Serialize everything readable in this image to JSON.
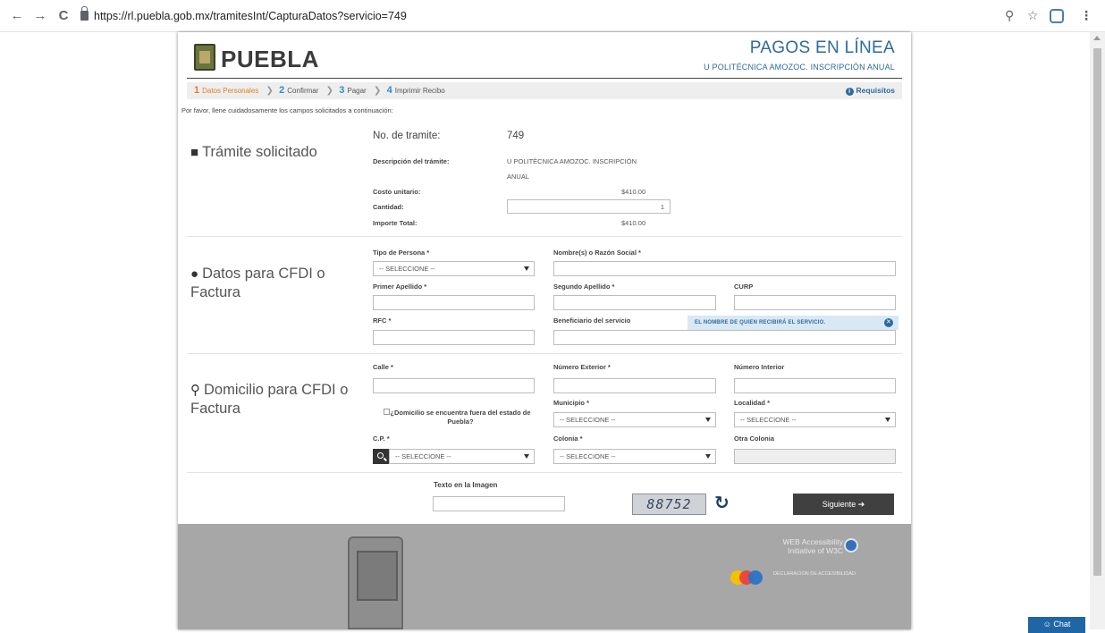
{
  "browser": {
    "url": "https://rl.puebla.gob.mx/tramitesInt/CapturaDatos?servicio=749",
    "back_icon": "←",
    "forward_icon": "→",
    "reload_icon": "C",
    "zoom_icon": "⚲",
    "star_icon": "☆",
    "menu_icon": "⋮"
  },
  "header": {
    "brand": "PUEBLA",
    "title": "PAGOS EN LÍNEA",
    "subtitle": "U POLITÉCNICA AMOZOC. INSCRIPCIÓN ANUAL"
  },
  "steps": [
    {
      "num": "1",
      "label": "Datos Personales"
    },
    {
      "num": "2",
      "label": "Confirmar"
    },
    {
      "num": "3",
      "label": "Pagar"
    },
    {
      "num": "4",
      "label": "Imprimir Recibo"
    }
  ],
  "requisitos": "Requisitos",
  "intro": "Por favor, llene cuidadosamente los campos solicitados a continuación:",
  "tramite": {
    "section_title": "Trámite solicitado",
    "no_label": "No. de tramite:",
    "no_value": "749",
    "desc_label": "Descripción del trámite:",
    "desc_value_line1": "U POLITÉCNICA AMOZOC. INSCRIPCIÓN",
    "desc_value_line2": "ANUAL",
    "costo_label": "Costo unitario:",
    "costo_value": "$410.00",
    "cantidad_label": "Cantidad:",
    "cantidad_value": "1",
    "importe_label": "Importe Total:",
    "importe_value": "$410.00"
  },
  "cfdi": {
    "section_title": "Datos para CFDI o Factura",
    "tipo_persona_label": "Tipo de Persona *",
    "tipo_persona_value": "-- SELECCIONE --",
    "nombre_label": "Nombre(s) o Razón Social *",
    "primer_apellido_label": "Primer Apellido *",
    "segundo_apellido_label": "Segundo Apellido *",
    "curp_label": "CURP",
    "rfc_label": "RFC *",
    "beneficiario_label": "Beneficiario del servicio",
    "tooltip": "EL NOMBRE DE QUIEN RECIBIRÁ EL SERVICIO."
  },
  "domicilio": {
    "section_title": "Domicilio para CFDI o Factura",
    "calle_label": "Calle *",
    "num_ext_label": "Número Exterior *",
    "num_int_label": "Número Interior",
    "municipio_label": "Municipio *",
    "localidad_label": "Localidad *",
    "fuera_label": "¿Domicilio se encuentra fuera del estado de Puebla?",
    "cp_label": "C.P. *",
    "colonia_label": "Colonia *",
    "otra_colonia_label": "Otra Colonia",
    "select_placeholder": "-- SELECCIONE --"
  },
  "captcha": {
    "label": "Texto en la Imagen",
    "image_text": "88752",
    "refresh_icon": "↻",
    "next_button": "Siguiente ➔"
  },
  "footer": {
    "w3c_text": "WEB Accessibility Initiative of W3C",
    "declaracion": "DECLARACIÓN DE ACCESIBILIDAD"
  },
  "chat": "Chat",
  "colors": {
    "accent_blue": "#2c6b9d",
    "step_active": "#e67e22",
    "button_dark": "#404040",
    "footer_gray": "#a7a7a7"
  }
}
